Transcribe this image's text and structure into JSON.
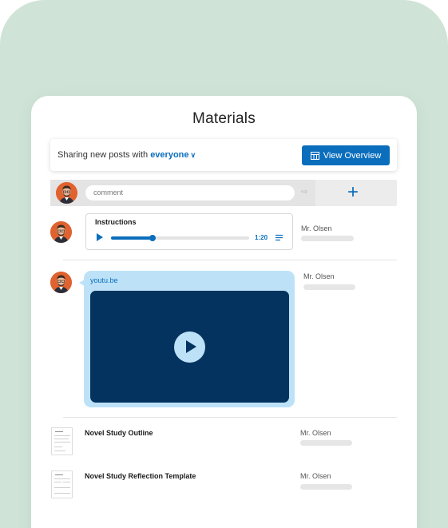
{
  "page": {
    "title": "Materials"
  },
  "sharing": {
    "prefix": "Sharing new posts with",
    "audience": "everyone",
    "view_overview_label": "View Overview"
  },
  "composer": {
    "placeholder": "comment"
  },
  "posts": [
    {
      "type": "audio",
      "title": "Instructions",
      "duration": "1:20",
      "progress": 0.3,
      "author": "Mr. Olsen"
    },
    {
      "type": "link",
      "link_text": "youtu.be",
      "author": "Mr. Olsen"
    }
  ],
  "documents": [
    {
      "title": "Novel Study Outline",
      "author": "Mr. Olsen"
    },
    {
      "title": "Novel Study Reflection Template",
      "author": "Mr. Olsen"
    }
  ],
  "colors": {
    "accent": "#0a6ebd",
    "background_blob": "#cfe3d7",
    "video_bg": "#04335f",
    "link_bubble": "#bde2f8",
    "avatar_bg": "#e0622f"
  }
}
